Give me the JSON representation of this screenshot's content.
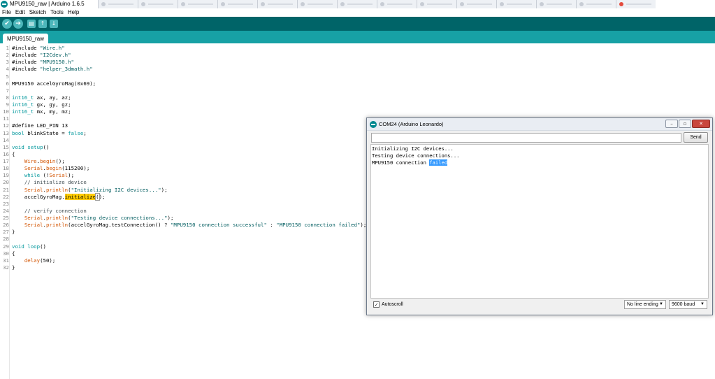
{
  "window": {
    "title": "MPU9150_raw | Arduino 1.6.5"
  },
  "menu": [
    "File",
    "Edit",
    "Sketch",
    "Tools",
    "Help"
  ],
  "toolbar": {
    "verify_icon": "✔",
    "upload_icon": "➔",
    "new_icon": "▤",
    "open_icon": "↑",
    "save_icon": "↓"
  },
  "sketch_tab": {
    "label": "MPU9150_raw"
  },
  "code": {
    "lines": [
      {
        "n": "1",
        "parts": [
          [
            "",
            "#include "
          ],
          [
            "str",
            "\"Wire.h\""
          ]
        ]
      },
      {
        "n": "2",
        "parts": [
          [
            "",
            "#include "
          ],
          [
            "str",
            "\"I2Cdev.h\""
          ]
        ]
      },
      {
        "n": "3",
        "parts": [
          [
            "",
            "#include "
          ],
          [
            "str",
            "\"MPU9150.h\""
          ]
        ]
      },
      {
        "n": "4",
        "parts": [
          [
            "",
            "#include "
          ],
          [
            "str",
            "\"helper_3dmath.h\""
          ]
        ]
      },
      {
        "n": "5",
        "parts": []
      },
      {
        "n": "6",
        "parts": [
          [
            "",
            "MPU9150 accelGyroMag(0x69);"
          ]
        ]
      },
      {
        "n": "7",
        "parts": []
      },
      {
        "n": "8",
        "parts": [
          [
            "kw",
            "int16_t"
          ],
          [
            "",
            " ax, ay, az;"
          ]
        ]
      },
      {
        "n": "9",
        "parts": [
          [
            "kw",
            "int16_t"
          ],
          [
            "",
            " gx, gy, gz;"
          ]
        ]
      },
      {
        "n": "10",
        "parts": [
          [
            "kw",
            "int16_t"
          ],
          [
            "",
            " mx, my, mz;"
          ]
        ]
      },
      {
        "n": "11",
        "parts": []
      },
      {
        "n": "12",
        "parts": [
          [
            "",
            "#define LED_PIN 13"
          ]
        ]
      },
      {
        "n": "13",
        "parts": [
          [
            "kw",
            "bool"
          ],
          [
            "",
            " blinkState = "
          ],
          [
            "kw",
            "false"
          ],
          [
            "",
            ";"
          ]
        ]
      },
      {
        "n": "14",
        "parts": []
      },
      {
        "n": "15",
        "parts": [
          [
            "kw",
            "void"
          ],
          [
            "",
            " "
          ],
          [
            "kw",
            "setup"
          ],
          [
            "",
            "()"
          ]
        ]
      },
      {
        "n": "16",
        "parts": [
          [
            "",
            "{"
          ]
        ]
      },
      {
        "n": "17",
        "parts": [
          [
            "",
            "    "
          ],
          [
            "fn",
            "Wire"
          ],
          [
            "",
            "."
          ],
          [
            "fn",
            "begin"
          ],
          [
            "",
            "();"
          ]
        ]
      },
      {
        "n": "18",
        "parts": [
          [
            "",
            "    "
          ],
          [
            "fn",
            "Serial"
          ],
          [
            "",
            "."
          ],
          [
            "fn",
            "begin"
          ],
          [
            "",
            "(115200);"
          ]
        ]
      },
      {
        "n": "19",
        "parts": [
          [
            "",
            "    "
          ],
          [
            "kw",
            "while"
          ],
          [
            "",
            " (!"
          ],
          [
            "fn",
            "Serial"
          ],
          [
            "",
            ");"
          ]
        ]
      },
      {
        "n": "20",
        "parts": [
          [
            "",
            "    "
          ],
          [
            "cm",
            "// initialize device"
          ]
        ]
      },
      {
        "n": "21",
        "parts": [
          [
            "",
            "    "
          ],
          [
            "fn",
            "Serial"
          ],
          [
            "",
            "."
          ],
          [
            "fn",
            "println"
          ],
          [
            "",
            "("
          ],
          [
            "str",
            "\"Initializing I2C devices...\""
          ],
          [
            "",
            ");"
          ]
        ]
      },
      {
        "n": "22",
        "parts": [
          [
            "",
            "    accelGyroMag."
          ],
          [
            "hl",
            "initialize"
          ],
          [
            "caret-paren",
            "("
          ],
          [
            "",
            ");"
          ]
        ]
      },
      {
        "n": "23",
        "parts": []
      },
      {
        "n": "24",
        "parts": [
          [
            "",
            "    "
          ],
          [
            "cm",
            "// verify connection"
          ]
        ]
      },
      {
        "n": "25",
        "parts": [
          [
            "",
            "    "
          ],
          [
            "fn",
            "Serial"
          ],
          [
            "",
            "."
          ],
          [
            "fn",
            "println"
          ],
          [
            "",
            "("
          ],
          [
            "str",
            "\"Testing device connections...\""
          ],
          [
            "",
            ");"
          ]
        ]
      },
      {
        "n": "26",
        "parts": [
          [
            "",
            "    "
          ],
          [
            "fn",
            "Serial"
          ],
          [
            "",
            "."
          ],
          [
            "fn",
            "println"
          ],
          [
            "",
            "(accelGyroMag.testConnection() ? "
          ],
          [
            "str",
            "\"MPU9150 connection successful\""
          ],
          [
            "",
            " : "
          ],
          [
            "str",
            "\"MPU9150 connection failed\""
          ],
          [
            "",
            ");"
          ]
        ]
      },
      {
        "n": "27",
        "parts": [
          [
            "",
            "}"
          ]
        ]
      },
      {
        "n": "28",
        "parts": []
      },
      {
        "n": "29",
        "parts": [
          [
            "kw",
            "void"
          ],
          [
            "",
            " "
          ],
          [
            "kw",
            "loop"
          ],
          [
            "",
            "()"
          ]
        ]
      },
      {
        "n": "30",
        "parts": [
          [
            "",
            "{"
          ]
        ]
      },
      {
        "n": "31",
        "parts": [
          [
            "",
            "    "
          ],
          [
            "fn",
            "delay"
          ],
          [
            "",
            "(50);"
          ]
        ]
      },
      {
        "n": "32",
        "parts": [
          [
            "",
            "}"
          ]
        ]
      }
    ]
  },
  "serial_monitor": {
    "title": "COM24 (Arduino Leonardo)",
    "input_value": "",
    "send_label": "Send",
    "output": [
      {
        "text": "Initializing I2C devices..."
      },
      {
        "text": "Testing device connections..."
      },
      {
        "text": "MPU9150 connection ",
        "selected": "failed"
      }
    ],
    "autoscroll_label": "Autoscroll",
    "autoscroll_checked": true,
    "line_ending": "No line ending",
    "baud": "9600 baud",
    "minimize_icon": "–",
    "maximize_icon": "▫",
    "close_icon": "✕"
  },
  "colors": {
    "toolbar": "#006468",
    "tabstrip": "#17a1a5",
    "keyword": "#00979c",
    "function": "#d35400",
    "string": "#005c5f",
    "highlight": "#ffcc00",
    "selection": "#3399ff"
  }
}
